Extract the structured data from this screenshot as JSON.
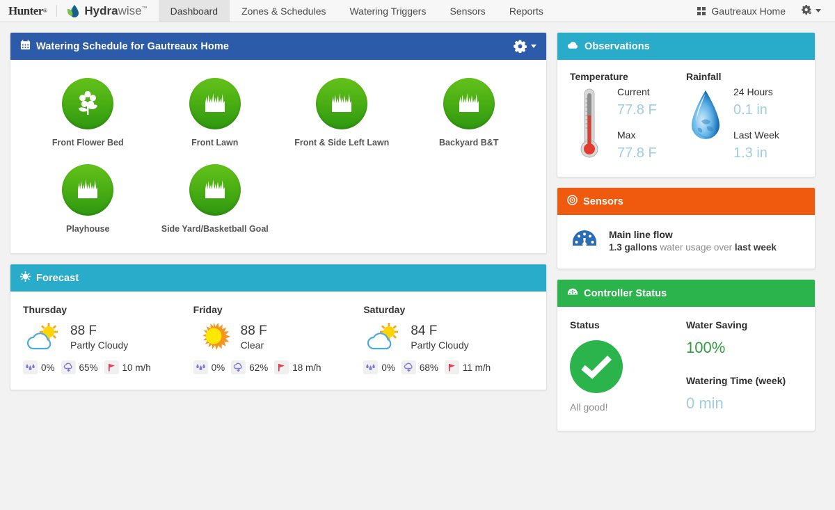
{
  "nav": {
    "brand_hunter": "Hunter",
    "brand_hunter_tm": "®",
    "brand_hydra_bold": "Hydra",
    "brand_hydra_light": "wise",
    "brand_hydra_tm": "™",
    "tabs": [
      {
        "label": "Dashboard",
        "active": true
      },
      {
        "label": "Zones & Schedules",
        "active": false
      },
      {
        "label": "Watering Triggers",
        "active": false
      },
      {
        "label": "Sensors",
        "active": false
      },
      {
        "label": "Reports",
        "active": false
      }
    ],
    "site_name": "Gautreaux Home",
    "site_icon": "grid-icon",
    "settings_icon": "gear-icon"
  },
  "schedule": {
    "title": "Watering Schedule for Gautreaux Home",
    "header_icon": "calendar-icon",
    "menu_icon": "gear-icon",
    "header_color": "#2c5baa",
    "zones": [
      {
        "label": "Front Flower Bed",
        "icon": "flower-icon"
      },
      {
        "label": "Front Lawn",
        "icon": "grass-icon"
      },
      {
        "label": "Front & Side Left Lawn",
        "icon": "grass-icon"
      },
      {
        "label": "Backyard B&T",
        "icon": "grass-icon"
      },
      {
        "label": "Playhouse",
        "icon": "grass-icon"
      },
      {
        "label": "Side Yard/Basketball Goal",
        "icon": "grass-icon"
      }
    ]
  },
  "forecast": {
    "title": "Forecast",
    "header_icon": "sun-icon",
    "header_color": "#29abca",
    "days": [
      {
        "day": "Thursday",
        "icon": "partly-cloudy-icon",
        "temp": "88 F",
        "condition": "Partly Cloudy",
        "rain_chance": "0%",
        "humidity": "65%",
        "wind": "10 m/h"
      },
      {
        "day": "Friday",
        "icon": "sun-icon",
        "temp": "88 F",
        "condition": "Clear",
        "rain_chance": "0%",
        "humidity": "62%",
        "wind": "18 m/h"
      },
      {
        "day": "Saturday",
        "icon": "partly-cloudy-icon",
        "temp": "84 F",
        "condition": "Partly Cloudy",
        "rain_chance": "0%",
        "humidity": "68%",
        "wind": "11 m/h"
      }
    ]
  },
  "observations": {
    "title": "Observations",
    "header_icon": "cloud-icon",
    "header_color": "#29abca",
    "temperature": {
      "title": "Temperature",
      "icon": "thermometer-icon",
      "current_label": "Current",
      "current_value": "77.8 F",
      "max_label": "Max",
      "max_value": "77.8 F"
    },
    "rainfall": {
      "title": "Rainfall",
      "icon": "water-drop-icon",
      "day_label": "24 Hours",
      "day_value": "0.1 in",
      "week_label": "Last Week",
      "week_value": "1.3 in"
    }
  },
  "sensors": {
    "title": "Sensors",
    "header_icon": "target-icon",
    "header_color": "#f05a0e",
    "item": {
      "icon": "flow-meter-icon",
      "name": "Main line flow",
      "amount": "1.3 gallons",
      "middle_text": " water usage over ",
      "period": "last week"
    }
  },
  "controller": {
    "title": "Controller Status",
    "header_icon": "gauge-icon",
    "header_color": "#2bb34c",
    "status_label": "Status",
    "status_icon": "check-circle-icon",
    "status_text": "All good!",
    "water_saving_label": "Water Saving",
    "water_saving_value": "100%",
    "watering_time_label": "Watering Time (week)",
    "watering_time_value": "0 min"
  }
}
